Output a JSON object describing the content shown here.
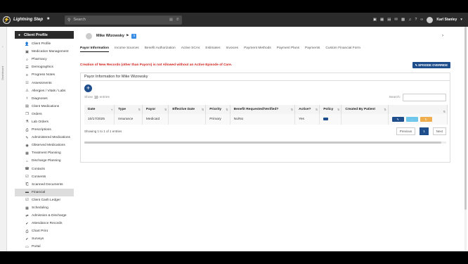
{
  "app": {
    "logo_letter": "⚡",
    "name": "Lightning Step",
    "star": "★"
  },
  "search": {
    "placeholder": "Search",
    "icon": "search-icon"
  },
  "topbar_icons": [
    "payment-icon",
    "calendar-icon",
    "monitor-icon",
    "chat-icon",
    "chart-icon",
    "bell-icon",
    "help-icon",
    "link-icon"
  ],
  "user": {
    "name": "Karl Stanley",
    "caret": "▾"
  },
  "rail": {
    "label": "Dashboard",
    "arrow": "‹"
  },
  "sidebar": {
    "header": "Client Profile",
    "items": [
      {
        "icon": "👤",
        "label": "Client Profile"
      },
      {
        "icon": "▣",
        "label": "Medication Management"
      },
      {
        "icon": "⌕",
        "label": "Pharmacy"
      },
      {
        "icon": "☰",
        "label": "Demographics"
      },
      {
        "icon": "≡",
        "label": "Progress Notes"
      },
      {
        "icon": "☷",
        "label": "Assessments"
      },
      {
        "icon": "⚠",
        "label": "Allergies / Vitals / Labs"
      },
      {
        "icon": "⚕",
        "label": "Diagnoses"
      },
      {
        "icon": "▤",
        "label": "Client Medications"
      },
      {
        "icon": "❐",
        "label": "Orders"
      },
      {
        "icon": "⚗",
        "label": "Lab Orders"
      },
      {
        "icon": "⎙",
        "label": "Prescriptions"
      },
      {
        "icon": "✎",
        "label": "Administered Medications"
      },
      {
        "icon": "◉",
        "label": "Observed Medications"
      },
      {
        "icon": "▦",
        "label": "Treatment Planning"
      },
      {
        "icon": "⌂",
        "label": "Discharge Planning"
      },
      {
        "icon": "☎",
        "label": "Contacts"
      },
      {
        "icon": "☑",
        "label": "Consents"
      },
      {
        "icon": "⎗",
        "label": "Scanned Documents"
      },
      {
        "icon": "▬",
        "label": "Financial"
      },
      {
        "icon": "☑",
        "label": "Client Cash Ledger"
      },
      {
        "icon": "▦",
        "label": "Scheduling"
      },
      {
        "icon": "⇄",
        "label": "Admission & Discharge"
      },
      {
        "icon": "✔",
        "label": "Attendance Records"
      },
      {
        "icon": "⎙",
        "label": "Chart Print"
      },
      {
        "icon": "✔",
        "label": "Surveys"
      },
      {
        "icon": "▭",
        "label": "Portal"
      }
    ],
    "active_index": 19
  },
  "patient": {
    "name": "Mike Wizowsky",
    "flag": "⚑",
    "badge": "ℹ",
    "chevron": "›"
  },
  "tabs": [
    "Payor Information",
    "Income Sources",
    "Benefit Authorization",
    "Active SCAs",
    "Estimates",
    "Invoices",
    "Payment Methods",
    "Payment Plans",
    "Payments",
    "Custom Financial Form"
  ],
  "active_tab": 0,
  "warning": "Creation of New Records (other than Payors) is not Allowed without an Active Episode of Care.",
  "override_button": "✎ EPISODE OVERRIDE",
  "panel": {
    "title": "Payor Information for Mike Wizowsky",
    "add": "+",
    "show_label": "Show",
    "entries_value": "10",
    "entries_label": "entries",
    "search_label": "Search:",
    "columns": [
      "Date",
      "Type",
      "Payor",
      "Effective Date",
      "Priority",
      "Benefit Requested/Verified?",
      "Active?",
      "Policy",
      "Created By Patient",
      ""
    ],
    "rows": [
      {
        "date": "10/17/2025",
        "type": "Insurance",
        "payor": "Medicaid",
        "effective_date": "",
        "priority": "Primary",
        "benefit": "No/No",
        "active": "Yes",
        "policy": "policy-icon",
        "created_by_patient": ""
      }
    ],
    "actions": [
      "✎",
      "…",
      "↻"
    ],
    "footer": "Showing 1 to 1 of 1 entries",
    "prev": "Previous",
    "page": "1",
    "next": "Next"
  }
}
